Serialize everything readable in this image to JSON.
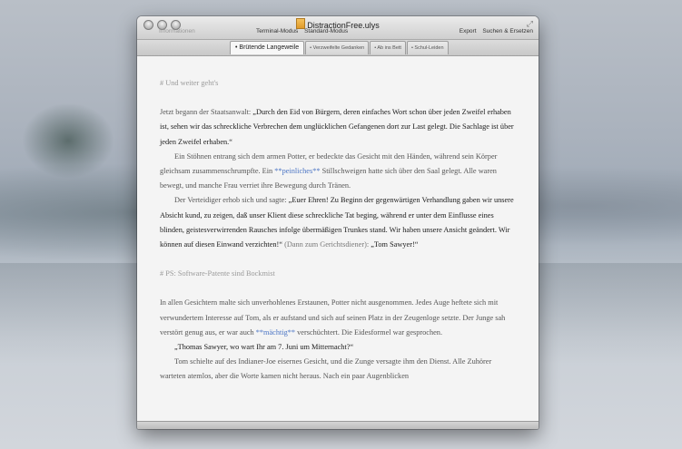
{
  "window": {
    "title": "DistractionFree.ulys",
    "info_label": "Informationen",
    "modes": [
      "Terminal-Modus",
      "Standard-Modus"
    ],
    "actions": [
      "Export",
      "Suchen & Ersetzen"
    ]
  },
  "tabs": [
    {
      "label": "• Brütende Langeweile",
      "active": true
    },
    {
      "label": "• Verzweifelte Gedanken",
      "active": false
    },
    {
      "label": "• Ab ins Bett",
      "active": false
    },
    {
      "label": "• Schul-Leiden",
      "active": false
    }
  ],
  "document": {
    "heading1": "# Und weiter geht's",
    "p1_a": "Jetzt begann der Staatsanwalt: ",
    "p1_b": "„Durch den Eid von Bürgern, deren einfaches Wort schon über jeden Zweifel erhaben ist, sehen wir das schreckliche Verbrechen dem unglücklichen Gefangenen dort zur Last gelegt. Die Sachlage ist über jeden Zweifel erhaben.“",
    "p2_a": "Ein Stöhnen entrang sich dem armen Potter, er bedeckte das Gesicht mit den Händen, während sein Körper gleichsam zusammenschrumpfte. Ein ",
    "p2_mark": "**peinliches**",
    "p2_b": " Stillschweigen hatte sich über den Saal gelegt. Alle waren bewegt, und manche Frau verriet ihre Bewegung durch Tränen.",
    "p3_a": "Der Verteidiger erhob sich und sagte: ",
    "p3_b": "„Euer Ehren! Zu Beginn der gegenwärtigen Verhandlung gaben wir unsere Absicht kund, zu zeigen, daß unser Klient diese schreckliche Tat beging, während er unter dem Einflusse eines blinden, geistesverwirrenden Rausches infolge übermäßigen Trunkes stand. Wir haben unsere Ansicht geändert. Wir können auf diesen Einwand verzichten!“",
    "p3_c": " (Dann zum Gerichtsdiener): ",
    "p3_d": "„Tom Sawyer!“",
    "heading2": "# PS: Software-Patente sind Bockmist",
    "p4_a": "In allen Gesichtern malte sich unverhohlenes Erstaunen, Potter nicht ausgenommen. Jedes Auge heftete sich mit verwundertem Interesse auf Tom, als er aufstand und sich auf seinen Platz in der Zeugenloge setzte. Der Junge sah verstört genug aus, er war auch ",
    "p4_mark": "**mächtig**",
    "p4_b": " verschüchtert. Die Eidesformel war gesprochen.",
    "p5": "„Thomas Sawyer, wo wart Ihr am 7. Juni um Mitternacht?“",
    "p6": "Tom schielte auf des Indianer-Joe eisernes Gesicht, und die Zunge versagte ihm den Dienst. Alle Zuhörer warteten atemlos, aber die Worte kamen nicht heraus. Nach ein paar Augenblicken"
  }
}
